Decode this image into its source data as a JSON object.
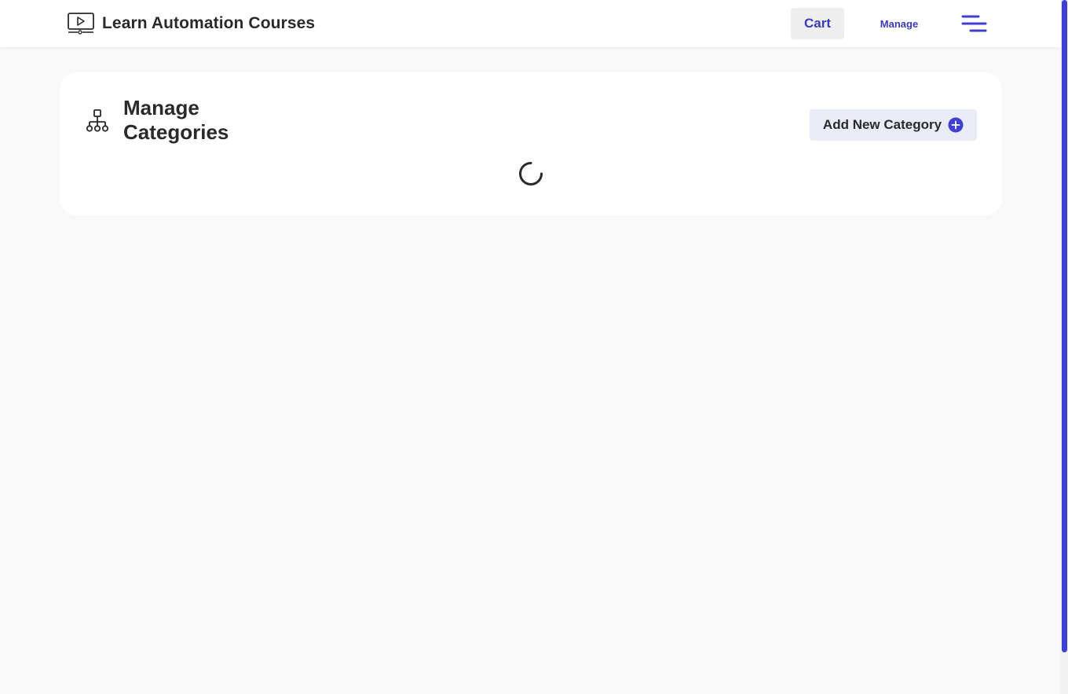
{
  "header": {
    "brand_title": "Learn Automation Courses",
    "cart_label": "Cart",
    "manage_label": "Manage",
    "brand_icon": "video-monitor-icon",
    "menu_icon": "hamburger-menu-icon"
  },
  "main": {
    "title": "Manage Categories",
    "title_icon": "sitemap-icon",
    "add_button_label": "Add New Category",
    "add_button_icon": "plus-circle-icon",
    "loading_indicator": "spinner-icon"
  },
  "colors": {
    "accent": "#3f3fd1",
    "link": "#3b3bb8",
    "background": "#f7f8f7",
    "card": "#ffffff",
    "button_bg": "#e9ebf6"
  }
}
